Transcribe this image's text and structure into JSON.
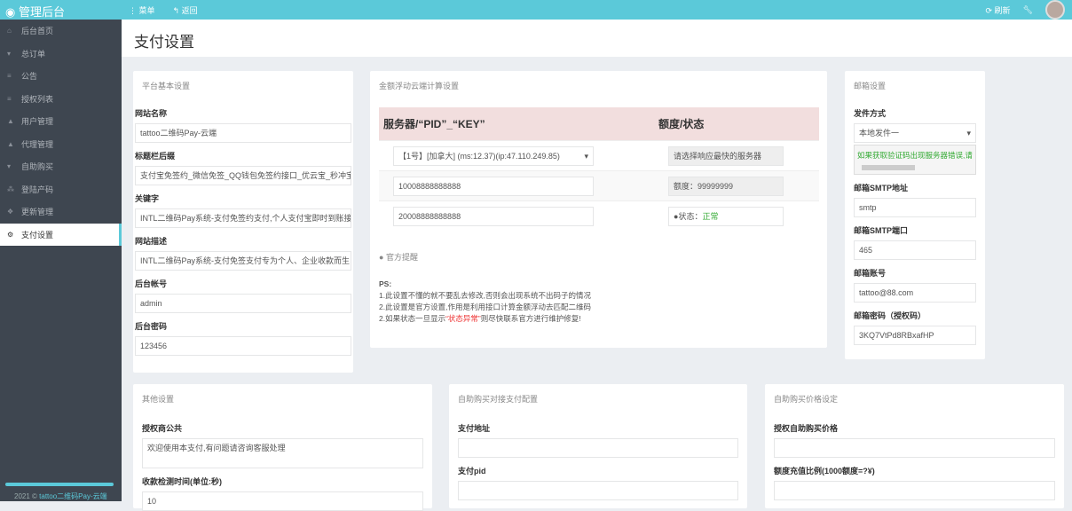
{
  "topbar": {
    "brand": "管理后台",
    "menu": "菜单",
    "back": "返回",
    "refresh": "刷新"
  },
  "sidebar": {
    "items": [
      {
        "label": "后台首页",
        "icon": "home-icon"
      },
      {
        "label": "总订单",
        "icon": "cart-icon"
      },
      {
        "label": "公告",
        "icon": "list-icon"
      },
      {
        "label": "授权列表",
        "icon": "list-icon"
      },
      {
        "label": "用户管理",
        "icon": "user-icon"
      },
      {
        "label": "代理管理",
        "icon": "user-icon"
      },
      {
        "label": "自助购买",
        "icon": "cart-icon"
      },
      {
        "label": "登陆产码",
        "icon": "sitemap-icon"
      },
      {
        "label": "更新管理",
        "icon": "cubes-icon"
      },
      {
        "label": "支付设置",
        "icon": "cogs-icon"
      }
    ],
    "footer_year": "2021 ©",
    "footer_link": "tattoo二维码Pay-云端"
  },
  "page_title": "支付设置",
  "basic": {
    "title": "平台基本设置",
    "fields": [
      {
        "label": "网站名称",
        "value": "tattoo二维码Pay-云端"
      },
      {
        "label": "标题栏后缀",
        "value": "支付宝免签约_微信免签_QQ钱包免签约接口_优云宝_秒冲宝"
      },
      {
        "label": "关键字",
        "value": "INTL二维码Pay系统-支付免签约支付,个人支付宝即时到账接口"
      },
      {
        "label": "网站描述",
        "value": "INTL二维码Pay系统-支付免签支付专为个人、企业收款而生"
      },
      {
        "label": "后台帐号",
        "value": "admin"
      },
      {
        "label": "后台密码",
        "value": "123456"
      }
    ]
  },
  "cloud": {
    "title": "金额浮动云端计算设置",
    "col1": "服务器/“PID”_“KEY”",
    "col2": "额度/状态",
    "server": "【1号】[加拿大] (ms:12.37)(ip:47.110.249.85)",
    "server_hint": "请选择响应最快的服务器",
    "pid": "10008888888888",
    "quota": "额度：99999999",
    "key": "20008888888888",
    "status_label": "状态：",
    "status_value": "正常",
    "notice_title": "官方提醒",
    "ps": "PS:",
    "lines": [
      "1.此设置不懂的就不要乱去修改,否则会出现系统不出码子的情况",
      "2.此设置是官方设置,作用是利用接口计算金额浮动去匹配二维码"
    ],
    "line3_pre": "2.如果状态一旦显示",
    "line3_red": "“状态异常”",
    "line3_post": "则尽快联系官方进行维护修复!"
  },
  "mail": {
    "title": "邮箱设置",
    "method_label": "发件方式",
    "method_value": "本地发件一",
    "hint": "如果获取验证码出现服务器错误,请",
    "smtp_label": "邮箱SMTP地址",
    "smtp_value": "smtp",
    "port_label": "邮箱SMTP端口",
    "port_value": "465",
    "account_label": "邮箱账号",
    "account_value": "tattoo@88.com",
    "pwd_label": "邮箱密码（授权码）",
    "pwd_value": "3KQ7VtPd8RBxafHP"
  },
  "other": {
    "title": "其他设置",
    "notice_label": "授权商公共",
    "notice_value": "欢迎使用本支付,有问题请咨询客服处理",
    "check_label": "收款检测时间(单位:秒)",
    "check_value": "10"
  },
  "selfpay": {
    "title": "自助购买对接支付配置",
    "url_label": "支付地址",
    "url_value": "",
    "pid_label": "支付pid",
    "pid_value": ""
  },
  "price": {
    "title": "自助购买价格设定",
    "price_label": "授权自助购买价格",
    "price_value": "",
    "ratio_label": "额度充值比例(1000额度=?¥)",
    "ratio_value": ""
  }
}
